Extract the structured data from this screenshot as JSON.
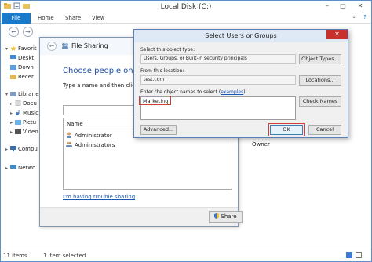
{
  "explorer": {
    "title": "Local Disk (C:)",
    "ribbon_tabs": [
      "File",
      "Home",
      "Share",
      "View"
    ],
    "nav_items": [
      {
        "label": "Favorites",
        "icon": "star-icon"
      },
      {
        "label": "Desktop",
        "icon": "desktop-icon"
      },
      {
        "label": "Downloads",
        "icon": "downloads-icon"
      },
      {
        "label": "Recent places",
        "icon": "recent-icon"
      },
      {
        "label": "Libraries",
        "icon": "libraries-icon"
      },
      {
        "label": "Documents",
        "icon": "documents-icon"
      },
      {
        "label": "Music",
        "icon": "music-icon"
      },
      {
        "label": "Pictures",
        "icon": "pictures-icon"
      },
      {
        "label": "Videos",
        "icon": "videos-icon"
      },
      {
        "label": "Computer",
        "icon": "computer-icon"
      },
      {
        "label": "Network",
        "icon": "network-icon"
      }
    ],
    "nav_visible": [
      "Favorit",
      "Deskt",
      "Down",
      "Recer",
      "Librarie",
      "Docu",
      "Music",
      "Pictu",
      "Video",
      "Compu",
      "Netwo"
    ],
    "status_items": "11 items",
    "status_selected": "1 item selected",
    "behind_owner": "Owner"
  },
  "file_sharing": {
    "title": "File Sharing",
    "heading": "Choose people on yo",
    "instruction": "Type a name and then click",
    "list_header_name": "Name",
    "rows": [
      {
        "name": "Administrator",
        "icon": "user-icon"
      },
      {
        "name": "Administrators",
        "icon": "group-icon"
      }
    ],
    "trouble_link": "I'm having trouble sharing",
    "share_button": "Share"
  },
  "dialog": {
    "title": "Select Users or Groups",
    "object_type_label": "Select this object type:",
    "object_type_value": "Users, Groups, or Built-in security principals",
    "object_types_button": "Object Types...",
    "location_label": "From this location:",
    "location_value": "test.com",
    "locations_button": "Locations...",
    "names_label_prefix": "Enter the object names to select (",
    "names_label_link": "examples",
    "names_label_suffix": "):",
    "names_value": "Marketing",
    "check_names_button": "Check Names",
    "advanced_button": "Advanced...",
    "ok_button": "OK",
    "cancel_button": "Cancel",
    "close_glyph": "✕"
  },
  "colors": {
    "file_tab": "#1979ca",
    "close_button": "#c7302b",
    "highlight_box": "#d33c38",
    "heading_blue": "#1f4fa3"
  }
}
